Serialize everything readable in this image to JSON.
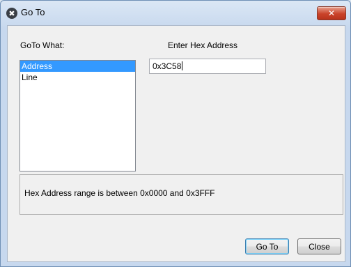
{
  "window": {
    "title": "Go To",
    "app_icon": "close-x-badge-icon",
    "close_glyph": "✕"
  },
  "labels": {
    "goto_what": "GoTo What:",
    "enter_hex": "Enter Hex Address"
  },
  "goto_list": {
    "items": [
      "Address",
      "Line"
    ],
    "selected": "Address"
  },
  "hex_input": {
    "value": "0x3C58"
  },
  "info": {
    "text": "Hex Address range is between 0x0000 and 0x3FFF"
  },
  "buttons": {
    "goto_label": "Go To",
    "close_label": "Close"
  },
  "colors": {
    "selection": "#3399ff",
    "close_button": "#c9432a"
  }
}
